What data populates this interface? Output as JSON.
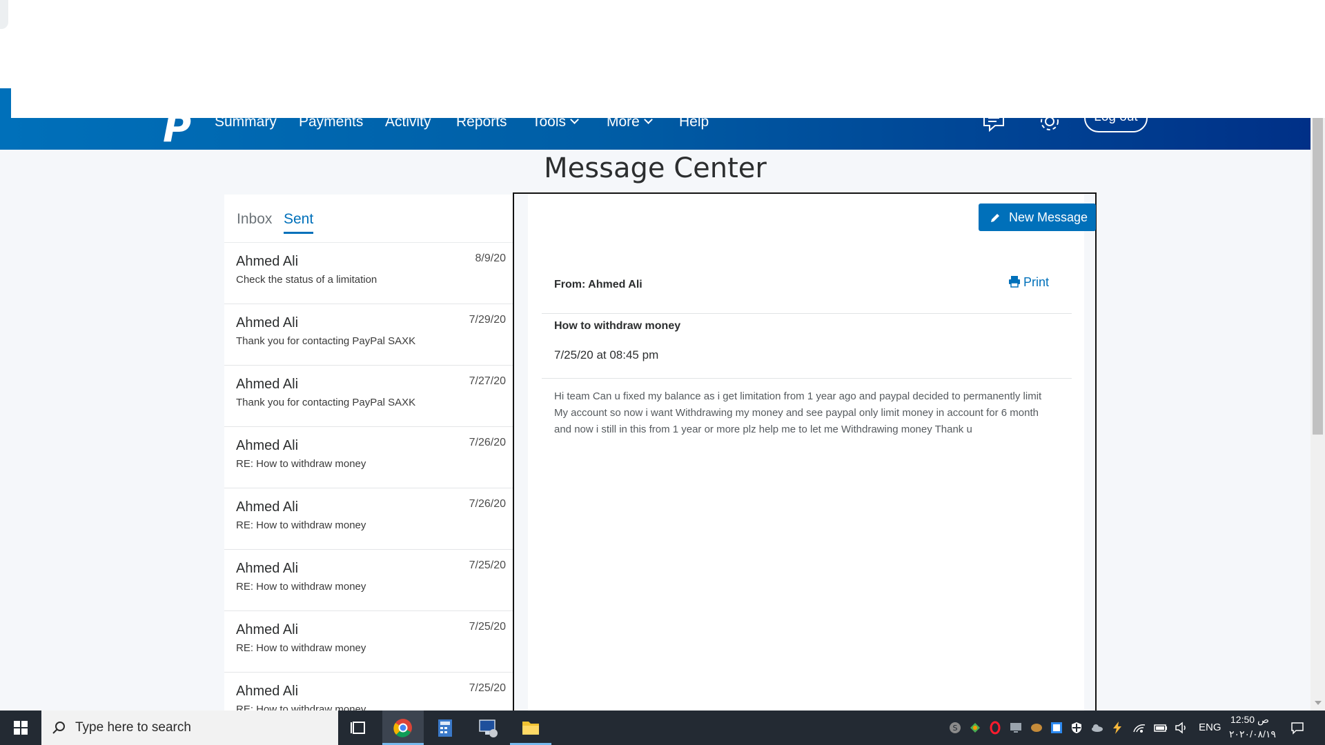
{
  "nav": {
    "logo": "P",
    "links": [
      "Summary",
      "Payments",
      "Activity",
      "Reports",
      "Tools",
      "More",
      "Help"
    ],
    "logout": "Log out"
  },
  "page": {
    "title": "Message Center"
  },
  "tabs": {
    "inbox": "Inbox",
    "sent": "Sent"
  },
  "messages": [
    {
      "sender": "Ahmed Ali",
      "date": "8/9/20",
      "subject": "Check the status of a limitation"
    },
    {
      "sender": "Ahmed Ali",
      "date": "7/29/20",
      "subject": "Thank you for contacting PayPal SAXK"
    },
    {
      "sender": "Ahmed Ali",
      "date": "7/27/20",
      "subject": "Thank you for contacting PayPal SAXK"
    },
    {
      "sender": "Ahmed Ali",
      "date": "7/26/20",
      "subject": "RE: How to withdraw money"
    },
    {
      "sender": "Ahmed Ali",
      "date": "7/26/20",
      "subject": "RE: How to withdraw money"
    },
    {
      "sender": "Ahmed Ali",
      "date": "7/25/20",
      "subject": "RE: How to withdraw money"
    },
    {
      "sender": "Ahmed Ali",
      "date": "7/25/20",
      "subject": "RE: How to withdraw money"
    },
    {
      "sender": "Ahmed Ali",
      "date": "7/25/20",
      "subject": "RE: How to withdraw money"
    }
  ],
  "detail": {
    "new_message": "New Message",
    "from": "From: Ahmed Ali",
    "print": "Print",
    "subject": "How to withdraw money",
    "timestamp": "7/25/20 at 08:45 pm",
    "body": "Hi team Can u fixed my balance as i get limitation from 1 year ago and paypal decided to permanently limit My account so now i want Withdrawing my money and see paypal only limit money in account for 6 month and now i still in this from 1 year or more plz help me to let me Withdrawing money Thank u"
  },
  "taskbar": {
    "search_placeholder": "Type here to search",
    "language": "ENG",
    "time": "12:50 ص",
    "date": "٢٠٢٠/٠٨/١٩"
  },
  "colors": {
    "accent": "#0070ba",
    "nav_dark": "#003087",
    "taskbar": "#232a33"
  }
}
